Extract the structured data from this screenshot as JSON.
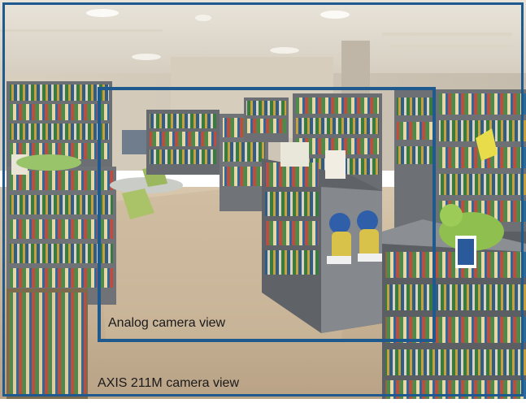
{
  "photo": {
    "subject": "library interior with bookshelves",
    "colors": {
      "frame": "#1f5a8e",
      "ceiling": "#efe8dc",
      "floor": "#c9b59a",
      "shelf": "#6f7377"
    }
  },
  "labels": {
    "analog": "Analog camera view",
    "axis": "AXIS 211M camera view"
  }
}
